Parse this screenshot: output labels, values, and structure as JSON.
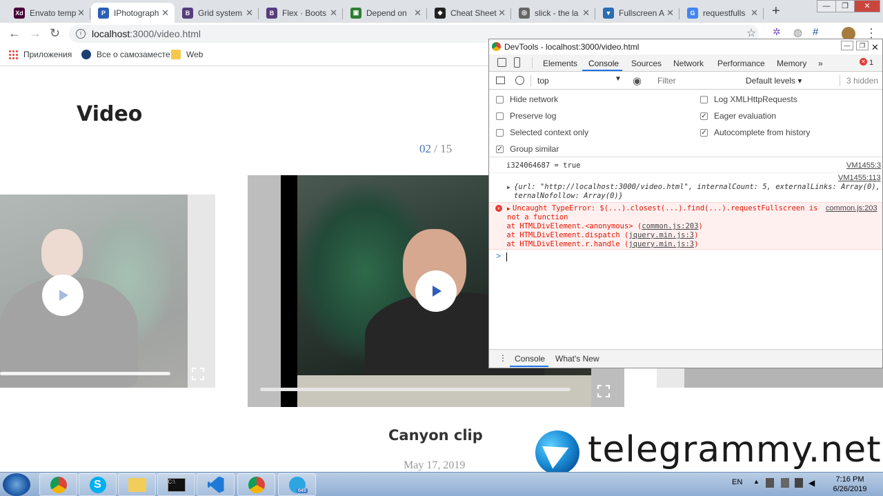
{
  "browser": {
    "tabs": [
      {
        "label": "Envato temp",
        "fav": "Xd",
        "color": "#470137",
        "active": false
      },
      {
        "label": "IPhotograph",
        "fav": "P",
        "color": "#2b5eb8",
        "active": true
      },
      {
        "label": "Grid system",
        "fav": "B",
        "color": "#563d7c",
        "active": false
      },
      {
        "label": "Flex · Boots",
        "fav": "B",
        "color": "#563d7c",
        "active": false
      },
      {
        "label": "Depend on",
        "fav": "▣",
        "color": "#2e7d32",
        "active": false
      },
      {
        "label": "Cheat Sheet",
        "fav": "◆",
        "color": "#222222",
        "active": false
      },
      {
        "label": "slick - the la",
        "fav": "◎",
        "color": "#666666",
        "active": false
      },
      {
        "label": "Fullscreen A",
        "fav": "▼",
        "color": "#2a6db0",
        "active": false
      },
      {
        "label": "requestfulls",
        "fav": "G",
        "color": "#4285f4",
        "active": false
      }
    ],
    "url_host": "localhost",
    "url_rest": ":3000/video.html",
    "bookmarks": [
      "Приложения",
      "Все о самозаместе",
      "Web"
    ]
  },
  "page": {
    "title": "Video",
    "counter_current": "02",
    "counter_sep": " / ",
    "counter_total": "15",
    "clip_title": "Canyon clip",
    "clip_date": "May 17, 2019"
  },
  "devtools": {
    "title": "DevTools - localhost:3000/video.html",
    "tabs": [
      "Elements",
      "Console",
      "Sources",
      "Network",
      "Performance",
      "Memory",
      "»"
    ],
    "active_tab": "Console",
    "error_count": "1",
    "context": "top",
    "filter_placeholder": "Filter",
    "levels": "Default levels ▾",
    "hidden": "3 hidden",
    "settings_left": [
      {
        "label": "Hide network",
        "checked": false
      },
      {
        "label": "Preserve log",
        "checked": false
      },
      {
        "label": "Selected context only",
        "checked": false
      },
      {
        "label": "Group similar",
        "checked": true
      }
    ],
    "settings_right": [
      {
        "label": "Log XMLHttpRequests",
        "checked": false
      },
      {
        "label": "Eager evaluation",
        "checked": true
      },
      {
        "label": "Autocomplete from history",
        "checked": true
      }
    ],
    "log1_text": "i324064687 = true",
    "log1_src": "VM1455:3",
    "log2_src": "VM1455:113",
    "log2_line1": "{url: \"http://localhost:3000/video.html\", internalCount: 5, externalLinks: Array(0), ex",
    "log2_line2": "ternalNofollow: Array(0)}",
    "error_line1": "Uncaught TypeError: $(...).closest(...).find(...).requestFullscreen is",
    "error_line2": "not a function",
    "error_src": "common.js:203",
    "stack": [
      {
        "prefix": "    at HTMLDivElement.<anonymous> (",
        "link": "common.js:203",
        "suffix": ")"
      },
      {
        "prefix": "    at HTMLDivElement.dispatch (",
        "link": "jquery.min.js:3",
        "suffix": ")"
      },
      {
        "prefix": "    at HTMLDivElement.r.handle (",
        "link": "jquery.min.js:3",
        "suffix": ")"
      }
    ],
    "prompt": ">",
    "drawer_tabs": [
      "Console",
      "What's New"
    ]
  },
  "watermark": "telegrammy.net",
  "taskbar": {
    "lang": "EN",
    "time": "7:16 PM",
    "date": "6/26/2019",
    "telegram_badge": "649"
  }
}
